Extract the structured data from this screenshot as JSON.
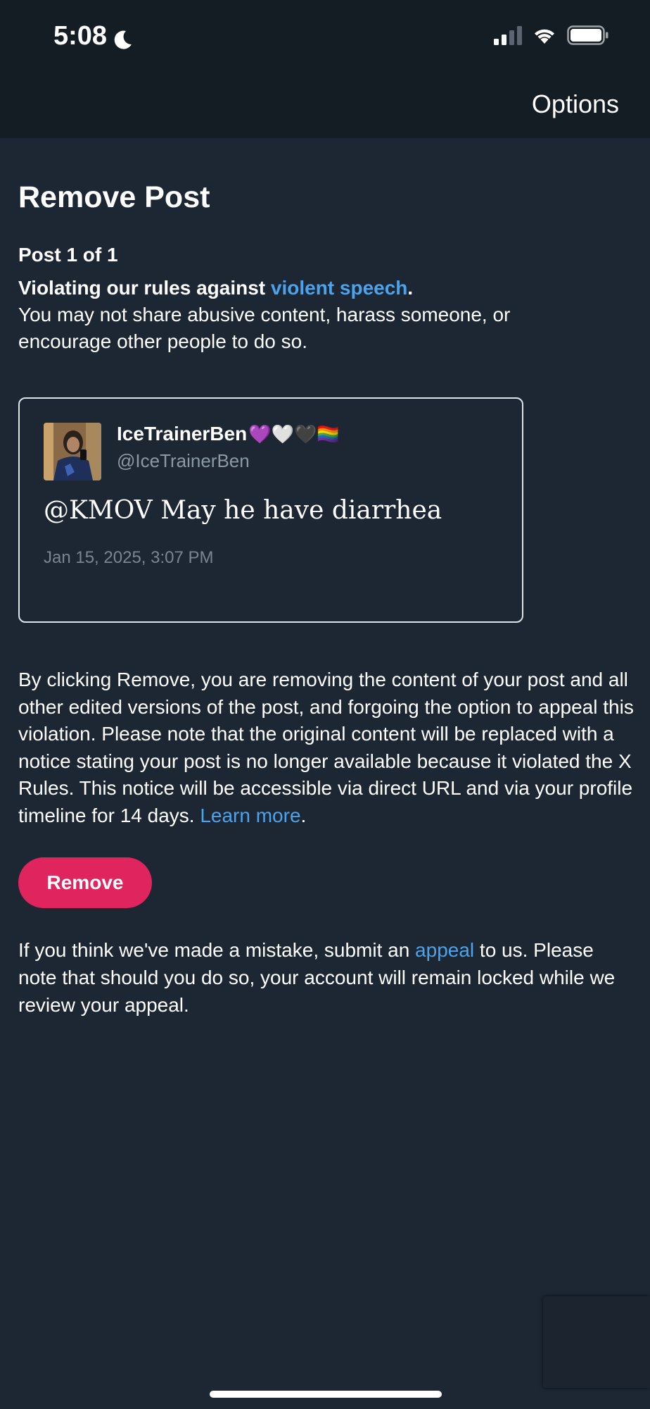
{
  "status_bar": {
    "time": "5:08",
    "icons": [
      "moon-icon",
      "signal-icon",
      "wifi-icon",
      "battery-icon"
    ]
  },
  "header": {
    "options_label": "Options"
  },
  "page": {
    "title": "Remove Post",
    "post_count": "Post 1 of 1",
    "violation_prefix": "Violating our rules against ",
    "violation_link": "violent speech",
    "violation_suffix": ".",
    "violation_description": "You may not share abusive content, harass someone, or encourage other people to do so."
  },
  "post": {
    "author_name": "IceTrainerBen",
    "author_emojis": "💜🤍🖤🏳️‍🌈",
    "author_handle": "@IceTrainerBen",
    "text": "@KMOV May he have diarrhea",
    "date": "Jan 15, 2025, 3:07 PM"
  },
  "removal": {
    "text": "By clicking Remove, you are removing the content of your post and all other edited versions of the post, and forgoing the option to appeal this violation. Please note that the original content will be replaced with a notice stating your post is no longer available because it violated the X Rules. This notice will be accessible via direct URL and via your profile timeline for 14 days. ",
    "learn_more_label": "Learn more",
    "learn_more_suffix": ".",
    "button_label": "Remove"
  },
  "appeal": {
    "prefix": "If you think we've made a mistake, submit an ",
    "link_label": "appeal",
    "suffix": " to us. Please note that should you do so, your account will remain locked while we review your appeal."
  },
  "colors": {
    "background": "#1d2733",
    "header_background": "#141c24",
    "link": "#4aa3ec",
    "remove_button": "#e0245e"
  }
}
